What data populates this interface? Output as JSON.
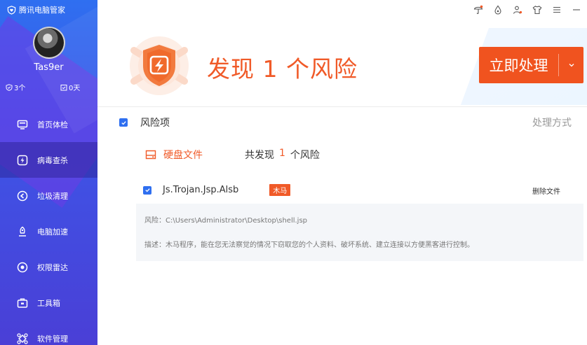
{
  "app": {
    "brand": "腾讯电脑管家"
  },
  "profile": {
    "username": "Tas9er",
    "stat_left": "3个",
    "stat_right": "0天"
  },
  "nav": {
    "items": [
      {
        "label": "首页体检",
        "icon": "monitor-icon",
        "active": false
      },
      {
        "label": "病毒查杀",
        "icon": "virus-shield-icon",
        "active": true
      },
      {
        "label": "垃圾清理",
        "icon": "broom-icon",
        "active": false
      },
      {
        "label": "电脑加速",
        "icon": "rocket-icon",
        "active": false
      },
      {
        "label": "权限雷达",
        "icon": "radar-icon",
        "active": false
      },
      {
        "label": "工具箱",
        "icon": "toolbox-icon",
        "active": false
      },
      {
        "label": "软件管理",
        "icon": "apps-icon",
        "active": false
      }
    ]
  },
  "topbar": {
    "icons": [
      "umbrella-icon",
      "drop-icon",
      "user-icon",
      "shirt-icon",
      "menu-icon",
      "minimize-icon"
    ]
  },
  "header": {
    "title": "发现 1 个风险",
    "action_label": "立即处理"
  },
  "table": {
    "col_item": "风险项",
    "col_handle": "处理方式",
    "category": "硬盘文件",
    "found_prefix": "共发现",
    "found_count": "1",
    "found_suffix": "个风险"
  },
  "risk": {
    "name": "Js.Trojan.Jsp.Alsb",
    "tag": "木马",
    "action": "删除文件",
    "path_line": "风险：C:\\Users\\Administrator\\Desktop\\shell.jsp",
    "desc_line": "描述：木马程序，能在您无法察觉的情况下窃取您的个人资料、破坏系统、建立连接以方便黑客进行控制。"
  },
  "colors": {
    "accent": "#f05a28",
    "primary": "#2f6ff0",
    "sidebar": "#3d56e8"
  }
}
